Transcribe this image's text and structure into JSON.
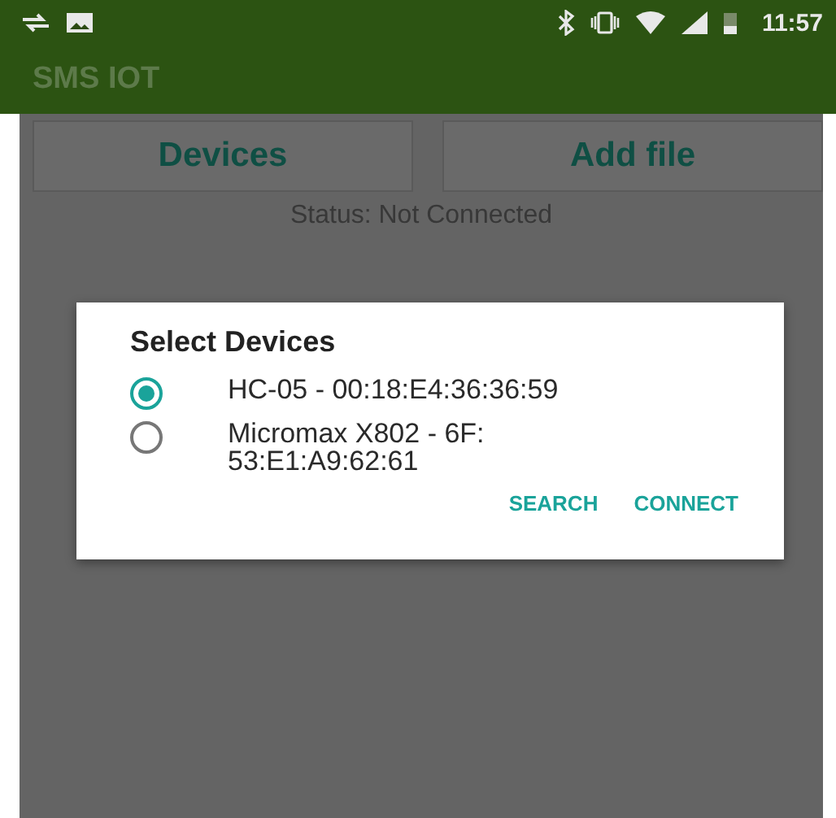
{
  "status_bar": {
    "time": "11:57"
  },
  "app_bar": {
    "title": "SMS IOT"
  },
  "buttons": [
    {
      "label": "Devices"
    },
    {
      "label": "Add file"
    }
  ],
  "status_text": "Status: Not Connected",
  "dialog": {
    "title": "Select Devices",
    "devices": [
      {
        "label_lines": [
          "HC-05 - 00:18:E4:36:36:59"
        ],
        "selected": true
      },
      {
        "label_lines": [
          "Micromax X802 - 6F:",
          "53:E1:A9:62:61"
        ],
        "selected": false
      }
    ],
    "actions": [
      {
        "label": "SEARCH"
      },
      {
        "label": "CONNECT"
      }
    ]
  }
}
